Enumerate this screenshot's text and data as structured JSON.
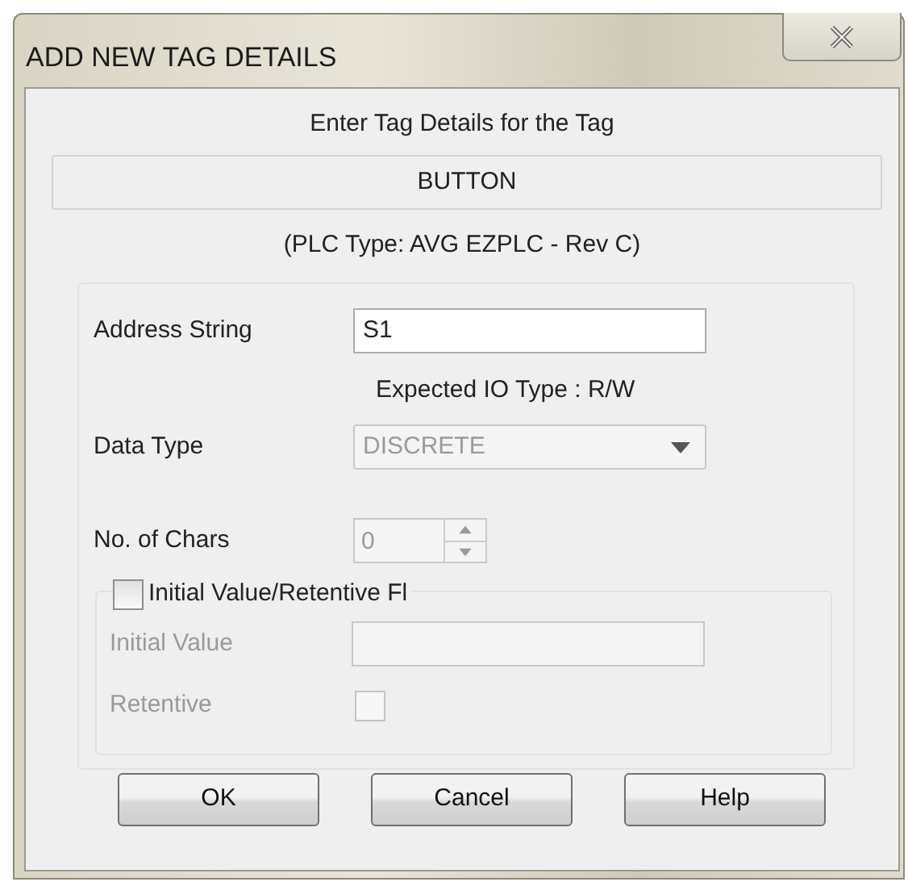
{
  "window": {
    "title": "ADD NEW TAG DETAILS"
  },
  "heading": "Enter Tag Details for the Tag",
  "tag_name": "BUTTON",
  "plc_type": "(PLC Type:  AVG EZPLC - Rev C)",
  "fields": [
    {
      "kind": "text",
      "label": "Address String",
      "value": "S1",
      "disabled": false
    },
    {
      "kind": "note",
      "text": "Expected IO Type : R/W"
    },
    {
      "kind": "select",
      "label": "Data Type",
      "value": "DISCRETE",
      "disabled": true
    },
    {
      "kind": "spinner",
      "label": "No. of Chars",
      "value": "0",
      "disabled": true
    }
  ],
  "initial_group": {
    "label": "Initial Value/Retentive Fl",
    "checked": false,
    "fields": [
      {
        "kind": "text",
        "label": "Initial Value",
        "disabled": true
      },
      {
        "kind": "checkbox",
        "label": "Retentive",
        "checked": false,
        "disabled": true
      }
    ]
  },
  "buttons": [
    "OK",
    "Cancel",
    "Help"
  ]
}
